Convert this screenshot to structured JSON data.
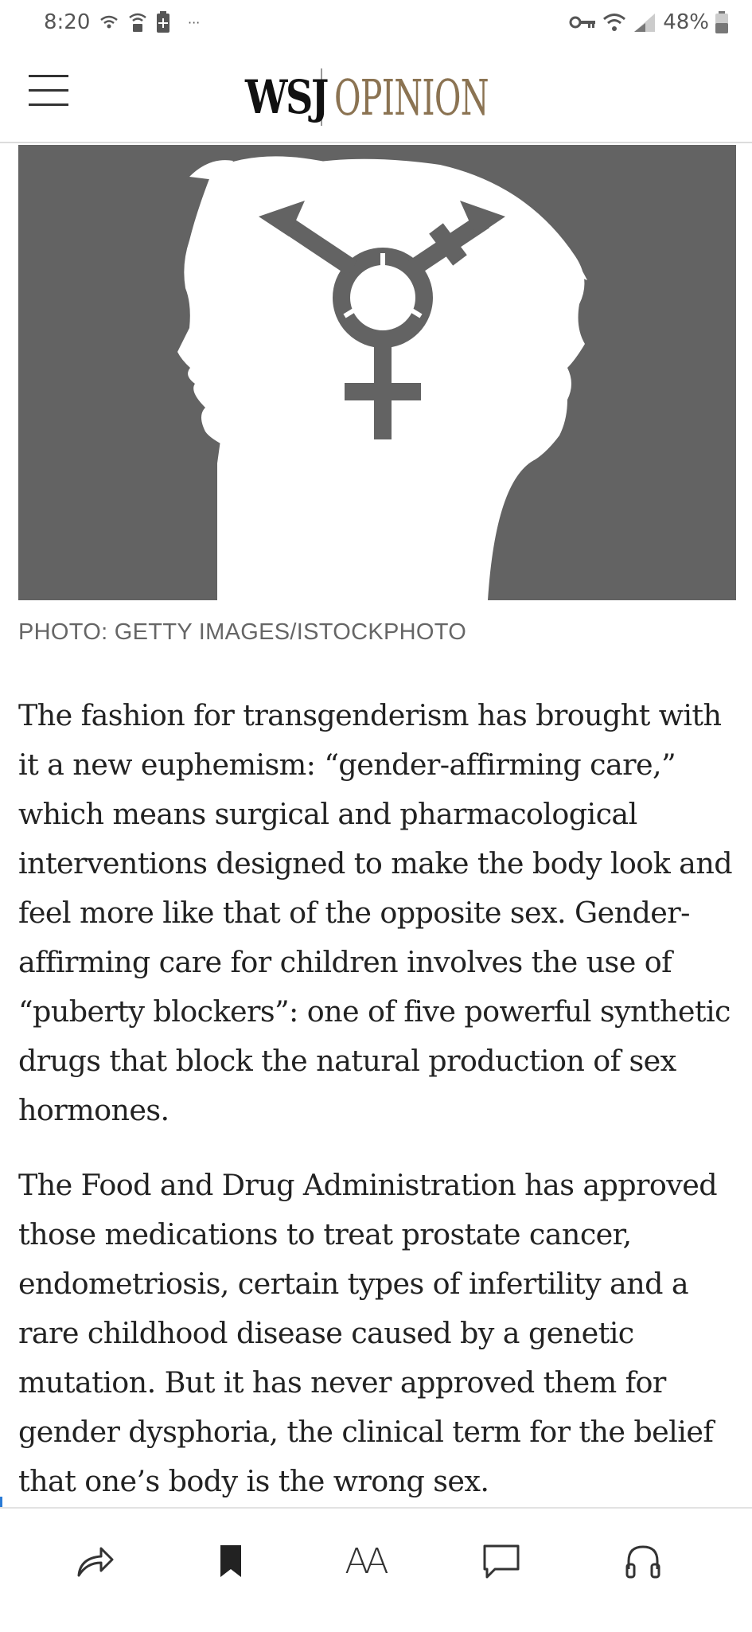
{
  "status_bar": {
    "time": "8:20",
    "left_icons": [
      "wifi-calling-icon",
      "wifi-lock-icon",
      "battery-saver-icon",
      "more-dots-icon"
    ],
    "more_indicator": "···",
    "right_icons": [
      "vpn-key-icon",
      "wifi-icon",
      "signal-icon",
      "battery-icon"
    ],
    "battery": "48%"
  },
  "header": {
    "menu_icon": "hamburger-menu-icon",
    "logo_wsj": "WSJ",
    "logo_section": "OPINION",
    "section_color": "#8b7352"
  },
  "hero": {
    "image": "two-head-silhouettes-with-transgender-symbol",
    "background_color": "#636363",
    "caption": "PHOTO: GETTY IMAGES/ISTOCKPHOTO"
  },
  "article": {
    "paragraphs": [
      "The fashion for transgenderism has brought with it a new euphemism: “gender-affirming care,” which means surgical and pharmacological interventions designed to make the body look and feel more like that of the opposite sex. Gender-affirming care for children involves the use of “puberty blockers”: one of five powerful synthetic drugs that block the natural production of sex hormones.",
      "The Food and Drug Administration has approved those medications to treat prostate cancer, endometriosis, certain types of infertility and a rare childhood disease caused by a genetic mutation. But it has never approved them for gender dysphoria, the clinical term for the belief that one’s body is the wrong sex."
    ]
  },
  "toolbar": {
    "buttons": [
      {
        "name": "share",
        "icon": "share-arrow-icon"
      },
      {
        "name": "save",
        "icon": "bookmark-icon"
      },
      {
        "name": "text-size",
        "icon": "text-size-icon",
        "label": "AA"
      },
      {
        "name": "comments",
        "icon": "comment-bubble-icon"
      },
      {
        "name": "listen",
        "icon": "headphones-icon"
      }
    ]
  }
}
